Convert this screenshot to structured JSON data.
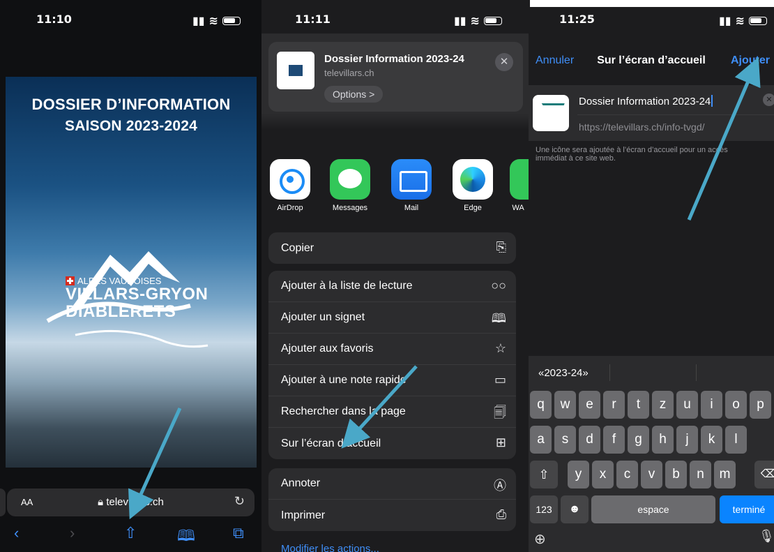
{
  "screen1": {
    "time": "11:10",
    "hero_line1": "DOSSIER D’INFORMATION",
    "hero_line2": "SAISON 2023-2024",
    "logo_sub": "ALPES VAUDOISES",
    "logo_line1": "VILLARS-GRYON",
    "logo_line2": "DIABLERETS",
    "addr_aa": "AA",
    "addr_url": "televillars.ch",
    "icons": [
      "back-icon",
      "forward-icon",
      "share-icon",
      "bookmarks-icon",
      "tabs-icon"
    ]
  },
  "screen2": {
    "time": "11:11",
    "card_title": "Dossier Information 2023-24",
    "card_url": "televillars.ch",
    "options_label": "Options >",
    "apps": [
      {
        "label": "AirDrop",
        "icon": "airdrop-icon"
      },
      {
        "label": "Messages",
        "icon": "messages-icon"
      },
      {
        "label": "Mail",
        "icon": "mail-icon"
      },
      {
        "label": "Edge",
        "icon": "edge-icon"
      },
      {
        "label": "WA",
        "icon": "whatsapp-icon"
      }
    ],
    "group1": [
      {
        "label": "Copier",
        "icon": "copy-icon"
      }
    ],
    "group2": [
      {
        "label": "Ajouter à la liste de lecture",
        "icon": "glasses-icon"
      },
      {
        "label": "Ajouter un signet",
        "icon": "book-icon"
      },
      {
        "label": "Ajouter aux favoris",
        "icon": "star-icon"
      },
      {
        "label": "Ajouter à une note rapide",
        "icon": "quick-note-icon"
      },
      {
        "label": "Rechercher dans la page",
        "icon": "find-in-page-icon"
      },
      {
        "label": "Sur l’écran d’accueil",
        "icon": "add-square-icon"
      }
    ],
    "group3": [
      {
        "label": "Annoter",
        "icon": "markup-icon"
      },
      {
        "label": "Imprimer",
        "icon": "print-icon"
      }
    ],
    "modify": "Modifier les actions..."
  },
  "screen3": {
    "time": "11:25",
    "cancel": "Annuler",
    "title": "Sur l’écran d’accueil",
    "add": "Ajouter",
    "name_value": "Dossier Information 2023-24",
    "url": "https://televillars.ch/info-tvgd/",
    "hint": "Une icône sera ajoutée à l’écran d’accueil pour un accès immédiat à ce site web.",
    "suggestion": "«2023-24»",
    "row1": [
      "q",
      "w",
      "e",
      "r",
      "t",
      "z",
      "u",
      "i",
      "o",
      "p"
    ],
    "row2": [
      "a",
      "s",
      "d",
      "f",
      "g",
      "h",
      "j",
      "k",
      "l"
    ],
    "row3": [
      "y",
      "x",
      "c",
      "v",
      "b",
      "n",
      "m"
    ],
    "key_123": "123",
    "key_space": "espace",
    "key_done": "terminé"
  },
  "colors": {
    "accent": "#3f8ef7",
    "arrow": "#4aa8c8"
  }
}
